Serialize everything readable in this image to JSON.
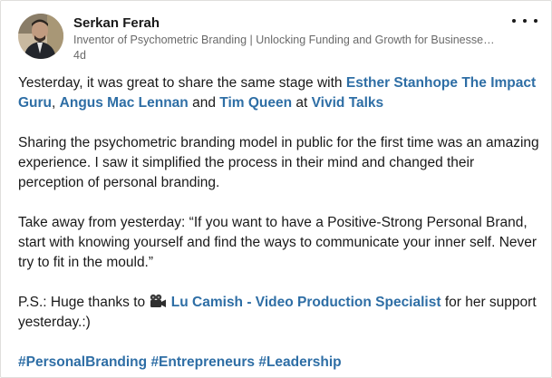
{
  "post": {
    "author": {
      "name": "Serkan Ferah",
      "headline": "Inventor of Psychometric Branding | Unlocking Funding and Growth for Businesse…",
      "time": "4d"
    },
    "more_icon": "ellipsis-horizontal-icon",
    "paragraphs": {
      "p1": {
        "t1": "Yesterday, it was great to share the same stage with ",
        "m1": "Esther Stanhope The Impact Guru",
        "t2": ", ",
        "m2": "Angus Mac Lennan",
        "t3": " and ",
        "m3": "Tim Queen",
        "t4": " at ",
        "m4": "Vivid Talks"
      },
      "p2": "Sharing the psychometric branding model in public for the first time was an amazing experience. I saw it simplified the process in their mind and changed their perception of personal branding.",
      "p3": "Take away from yesterday: “If you want to have a Positive-Strong Personal Brand, start with knowing yourself and find the ways to communicate your inner self. Never try to fit in the mould.”",
      "p4": {
        "t1": "P.S.: Huge thanks to ",
        "icon": "movie-camera-icon",
        "m1": "Lu Camish - Video Production Specialist",
        "t2": " for her support yesterday.:)"
      },
      "hashtags": [
        "#PersonalBranding",
        "#Entrepreneurs",
        "#Leadership"
      ]
    },
    "colors": {
      "link": "#2e6ea5",
      "text": "#191919",
      "secondary": "#666666"
    }
  }
}
